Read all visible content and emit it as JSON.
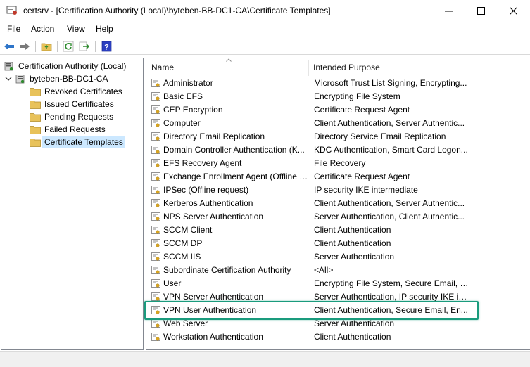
{
  "window": {
    "title": "certsrv - [Certification Authority (Local)\\byteben-BB-DC1-CA\\Certificate Templates]"
  },
  "menu": [
    "File",
    "Action",
    "View",
    "Help"
  ],
  "tree": {
    "root": "Certification Authority (Local)",
    "ca": "byteben-BB-DC1-CA",
    "folders": [
      "Revoked Certificates",
      "Issued Certificates",
      "Pending Requests",
      "Failed Requests",
      "Certificate Templates"
    ],
    "selected": "Certificate Templates"
  },
  "columns": {
    "name": "Name",
    "purpose": "Intended Purpose"
  },
  "templates": [
    {
      "name": "Administrator",
      "purpose": "Microsoft Trust List Signing, Encrypting..."
    },
    {
      "name": "Basic EFS",
      "purpose": "Encrypting File System"
    },
    {
      "name": "CEP Encryption",
      "purpose": "Certificate Request Agent"
    },
    {
      "name": "Computer",
      "purpose": "Client Authentication, Server Authentic..."
    },
    {
      "name": "Directory Email Replication",
      "purpose": "Directory Service Email Replication"
    },
    {
      "name": "Domain Controller Authentication (K...",
      "purpose": "KDC Authentication, Smart Card Logon..."
    },
    {
      "name": "EFS Recovery Agent",
      "purpose": "File Recovery"
    },
    {
      "name": "Exchange Enrollment Agent (Offline r...",
      "purpose": "Certificate Request Agent"
    },
    {
      "name": "IPSec (Offline request)",
      "purpose": "IP security IKE intermediate"
    },
    {
      "name": "Kerberos Authentication",
      "purpose": "Client Authentication, Server Authentic..."
    },
    {
      "name": "NPS Server Authentication",
      "purpose": "Server Authentication, Client Authentic..."
    },
    {
      "name": "SCCM Client",
      "purpose": "Client Authentication"
    },
    {
      "name": "SCCM DP",
      "purpose": "Client Authentication"
    },
    {
      "name": "SCCM IIS",
      "purpose": "Server Authentication"
    },
    {
      "name": "Subordinate Certification Authority",
      "purpose": "<All>"
    },
    {
      "name": "User",
      "purpose": "Encrypting File System, Secure Email, Cl..."
    },
    {
      "name": "VPN Server Authentication",
      "purpose": "Server Authentication, IP security IKE in..."
    },
    {
      "name": "VPN User Authentication",
      "purpose": "Client Authentication, Secure Email, En..."
    },
    {
      "name": "Web Server",
      "purpose": "Server Authentication"
    },
    {
      "name": "Workstation Authentication",
      "purpose": "Client Authentication"
    }
  ],
  "highlighted_template": "VPN User Authentication",
  "colors": {
    "selection": "#cce8ff",
    "highlight_border": "#1a9b7d",
    "folder": "#e8c25a"
  },
  "icons": [
    "app-certsrv-icon",
    "back-icon",
    "forward-icon",
    "up-folder-icon",
    "refresh-icon",
    "export-icon",
    "help-icon",
    "folder-icon",
    "ca-server-icon",
    "certificate-template-icon"
  ]
}
